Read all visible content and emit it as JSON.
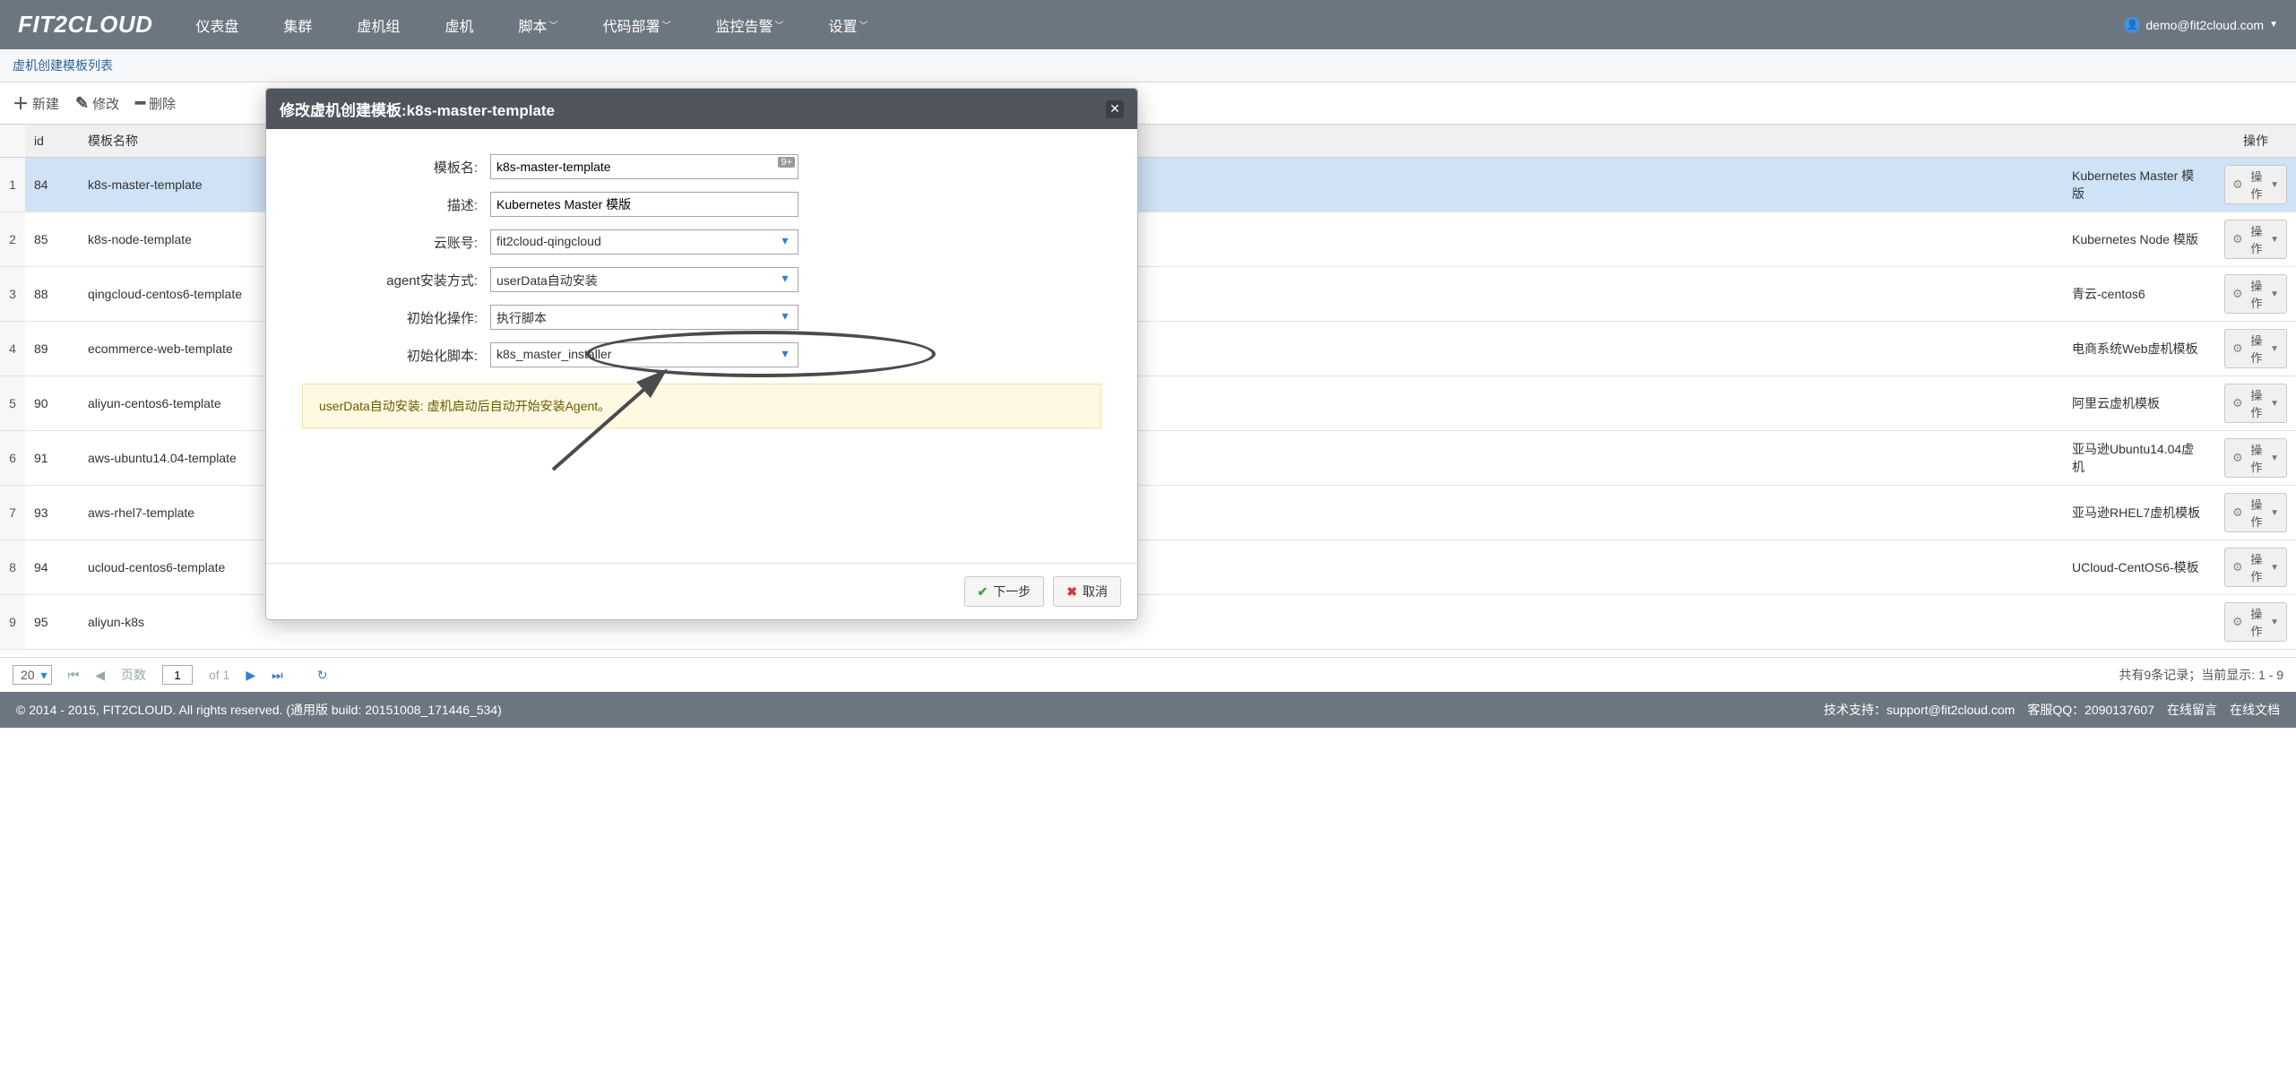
{
  "logo": "FIT2CLOUD",
  "nav": [
    "仪表盘",
    "集群",
    "虚机组",
    "虚机",
    "脚本",
    "代码部署",
    "监控告警",
    "设置"
  ],
  "nav_caret_idx": {
    "4": true,
    "5": true,
    "6": true,
    "7": true
  },
  "user_email": "demo@fit2cloud.com",
  "breadcrumb": "虚机创建模板列表",
  "toolbar": {
    "new": "新建",
    "edit": "修改",
    "del": "删除"
  },
  "cols": {
    "id": "id",
    "name": "模板名称",
    "op": "操作"
  },
  "rows": [
    {
      "n": "1",
      "id": "84",
      "name": "k8s-master-template",
      "desc": "Kubernetes Master 模版",
      "sel": true
    },
    {
      "n": "2",
      "id": "85",
      "name": "k8s-node-template",
      "desc": "Kubernetes Node 模版"
    },
    {
      "n": "3",
      "id": "88",
      "name": "qingcloud-centos6-template",
      "desc": "青云-centos6"
    },
    {
      "n": "4",
      "id": "89",
      "name": "ecommerce-web-template",
      "desc": "电商系统Web虚机模板"
    },
    {
      "n": "5",
      "id": "90",
      "name": "aliyun-centos6-template",
      "desc": "阿里云虚机模板"
    },
    {
      "n": "6",
      "id": "91",
      "name": "aws-ubuntu14.04-template",
      "desc": "亚马逊Ubuntu14.04虚机"
    },
    {
      "n": "7",
      "id": "93",
      "name": "aws-rhel7-template",
      "desc": "亚马逊RHEL7虚机模板"
    },
    {
      "n": "8",
      "id": "94",
      "name": "ucloud-centos6-template",
      "desc": "UCloud-CentOS6-模板"
    },
    {
      "n": "9",
      "id": "95",
      "name": "aliyun-k8s",
      "desc": ""
    }
  ],
  "op_label": "操作",
  "dialog": {
    "title": "修改虚机创建模板:k8s-master-template",
    "labels": {
      "name": "模板名:",
      "desc": "描述:",
      "acct": "云账号:",
      "agent": "agent安装方式:",
      "initop": "初始化操作:",
      "initscript": "初始化脚本:"
    },
    "values": {
      "name": "k8s-master-template",
      "desc": "Kubernetes Master 模版",
      "acct": "fit2cloud-qingcloud",
      "agent": "userData自动安装",
      "initop": "执行脚本",
      "initscript": "k8s_master_installer"
    },
    "info": "userData自动安装: 虚机启动后自动开始安装Agent。",
    "next": "下一步",
    "cancel": "取消"
  },
  "pager": {
    "size": "20",
    "pg_label": "页数",
    "pg": "1",
    "of": "of 1",
    "summary": "共有9条记录；当前显示: 1 - 9"
  },
  "footer": {
    "copy": "© 2014 - 2015, FIT2CLOUD. All rights reserved. (通用版 build: 20151008_171446_534)",
    "support_lbl": "技术支持：",
    "support": "support@fit2cloud.com",
    "qq_lbl": "客服QQ：",
    "qq": "2090137607",
    "msg": "在线留言",
    "doc": "在线文档"
  }
}
